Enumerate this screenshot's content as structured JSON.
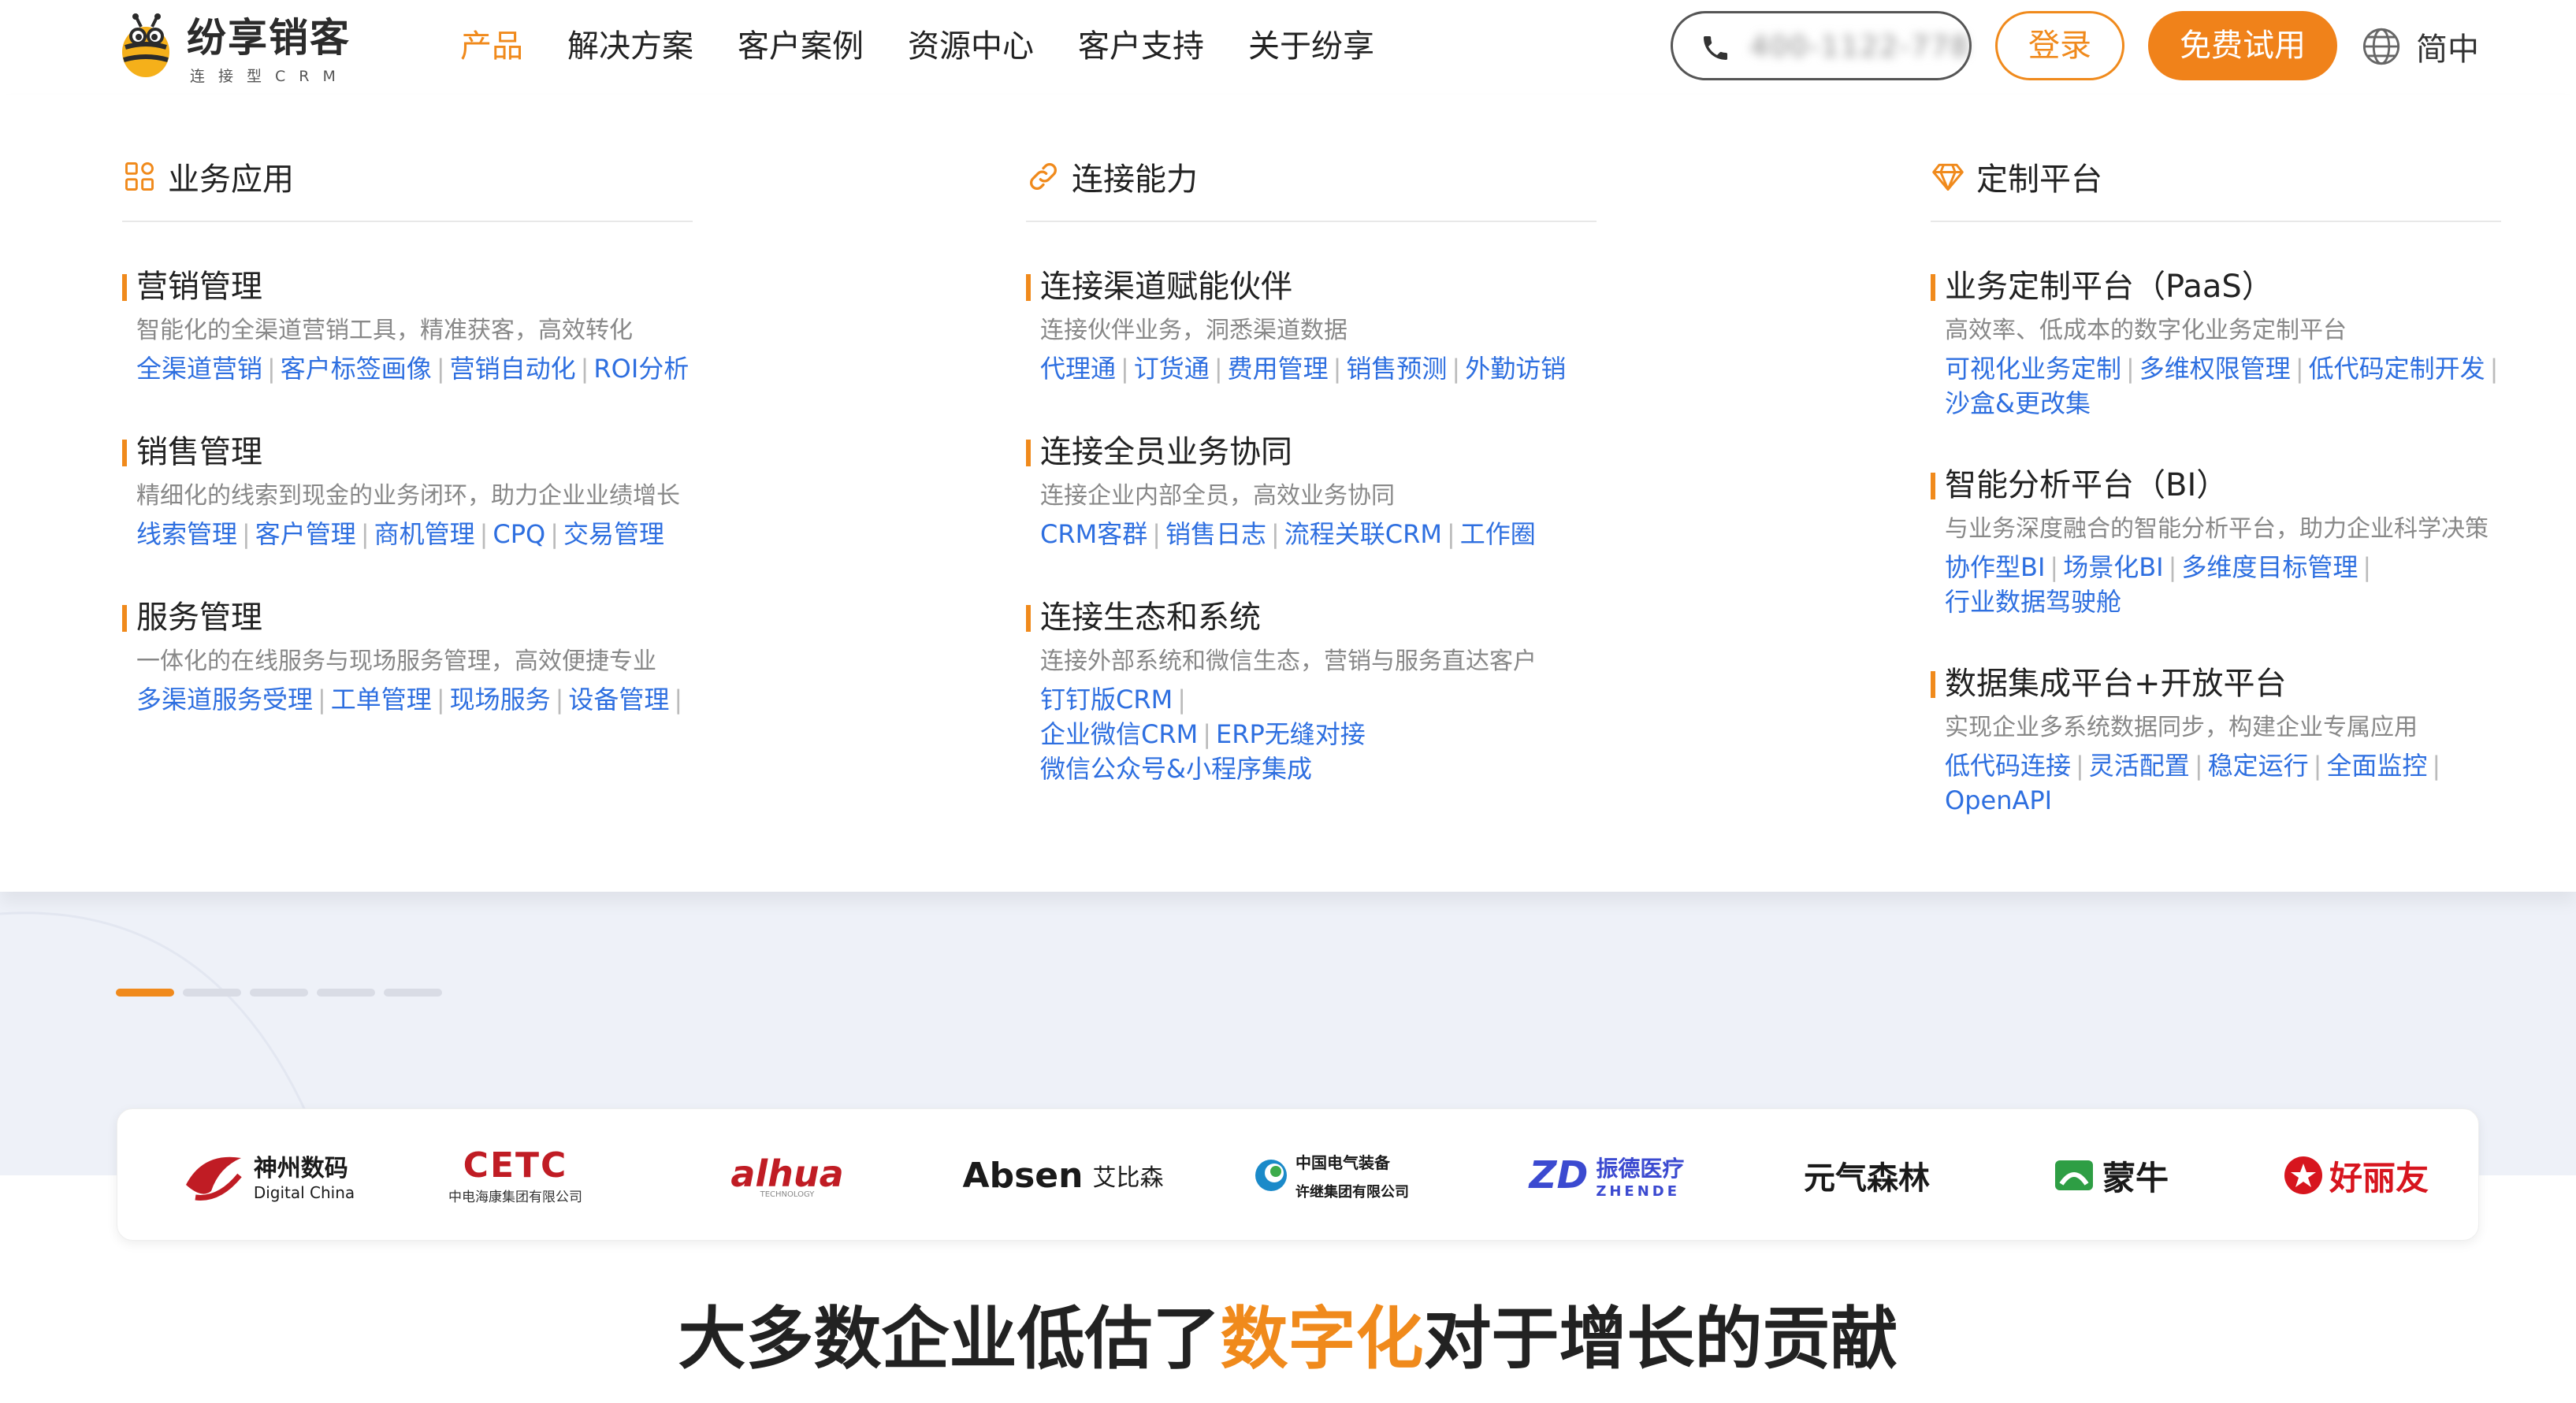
{
  "brand": {
    "name": "纷享销客",
    "subtitle": "连接型CRM",
    "accent_color": "#f08a1c",
    "link_color": "#2e6fe0"
  },
  "nav": {
    "items": [
      {
        "label": "产品",
        "active": true
      },
      {
        "label": "解决方案",
        "active": false
      },
      {
        "label": "客户案例",
        "active": false
      },
      {
        "label": "资源中心",
        "active": false
      },
      {
        "label": "客户支持",
        "active": false
      },
      {
        "label": "关于纷享",
        "active": false
      }
    ],
    "phone_icon": "phone-icon",
    "phone_number_blurred": "400-1122-778",
    "login_label": "登录",
    "trial_label": "免费试用",
    "language_icon": "globe-icon",
    "language_label": "简中"
  },
  "mega_menu": {
    "columns": [
      {
        "icon": "grid-apps-icon",
        "title": "业务应用",
        "sections": [
          {
            "title": "营销管理",
            "desc": "智能化的全渠道营销工具，精准获客，高效转化",
            "links": [
              "全渠道营销",
              "客户标签画像",
              "营销自动化",
              "ROI分析"
            ]
          },
          {
            "title": "销售管理",
            "desc": "精细化的线索到现金的业务闭环，助力企业业绩增长",
            "links": [
              "线索管理",
              "客户管理",
              "商机管理",
              "CPQ",
              "交易管理"
            ]
          },
          {
            "title": "服务管理",
            "desc": "一体化的在线服务与现场服务管理，高效便捷专业",
            "links": [
              "多渠道服务受理",
              "工单管理",
              "现场服务",
              "设备管理"
            ]
          }
        ]
      },
      {
        "icon": "link-icon",
        "title": "连接能力",
        "sections": [
          {
            "title": "连接渠道赋能伙伴",
            "desc": "连接伙伴业务，洞悉渠道数据",
            "links": [
              "代理通",
              "订货通",
              "费用管理",
              "销售预测",
              "外勤访销"
            ]
          },
          {
            "title": "连接全员业务协同",
            "desc": "连接企业内部全员，高效业务协同",
            "links": [
              "CRM客群",
              "销售日志",
              "流程关联CRM",
              "工作圈"
            ]
          },
          {
            "title": "连接生态和系统",
            "desc": "连接外部系统和微信生态，营销与服务直达客户",
            "links": [
              "钉钉版CRM",
              "企业微信CRM",
              "ERP无缝对接",
              "微信公众号&小程序集成"
            ]
          }
        ]
      },
      {
        "icon": "diamond-icon",
        "title": "定制平台",
        "sections": [
          {
            "title": "业务定制平台（PaaS）",
            "desc": "高效率、低成本的数字化业务定制平台",
            "links": [
              "可视化业务定制",
              "多维权限管理",
              "低代码定制开发",
              "沙盒&更改集"
            ]
          },
          {
            "title": "智能分析平台（BI）",
            "desc": "与业务深度融合的智能分析平台，助力企业科学决策",
            "links": [
              "协作型BI",
              "场景化BI",
              "多维度目标管理",
              "行业数据驾驶舱"
            ]
          },
          {
            "title": "数据集成平台+开放平台",
            "desc": "实现企业多系统数据同步，构建企业专属应用",
            "links": [
              "低代码连接",
              "灵活配置",
              "稳定运行",
              "全面监控",
              "OpenAPI"
            ]
          }
        ]
      }
    ]
  },
  "carousel": {
    "slides": 5,
    "active_index": 0
  },
  "client_logos": [
    {
      "text": "神州数码",
      "sub": "Digital China",
      "color": "#c01c24"
    },
    {
      "text": "CETC",
      "sub": "中电海康集团有限公司",
      "color": "#c01c24"
    },
    {
      "text": "alhua",
      "sub": "TECHNOLOGY",
      "color": "#c01c24"
    },
    {
      "text": "Absen",
      "sub": "艾比森",
      "color": "#1a1a1a"
    },
    {
      "text": "中国电气装备",
      "sub": "许继集团有限公司",
      "color": "#1a1a1a"
    },
    {
      "text": "振德医疗",
      "sub": "ZHENDE",
      "color": "#3b4ad0"
    },
    {
      "text": "元气森林",
      "sub": "",
      "color": "#1a1a1a"
    },
    {
      "text": "蒙牛",
      "sub": "",
      "color": "#1a1a1a"
    },
    {
      "text": "好丽友",
      "sub": "",
      "color": "#d7151e"
    }
  ],
  "headline": {
    "prefix": "大多数企业低估了",
    "highlight": "数字化",
    "suffix": "对于增长的贡献"
  }
}
